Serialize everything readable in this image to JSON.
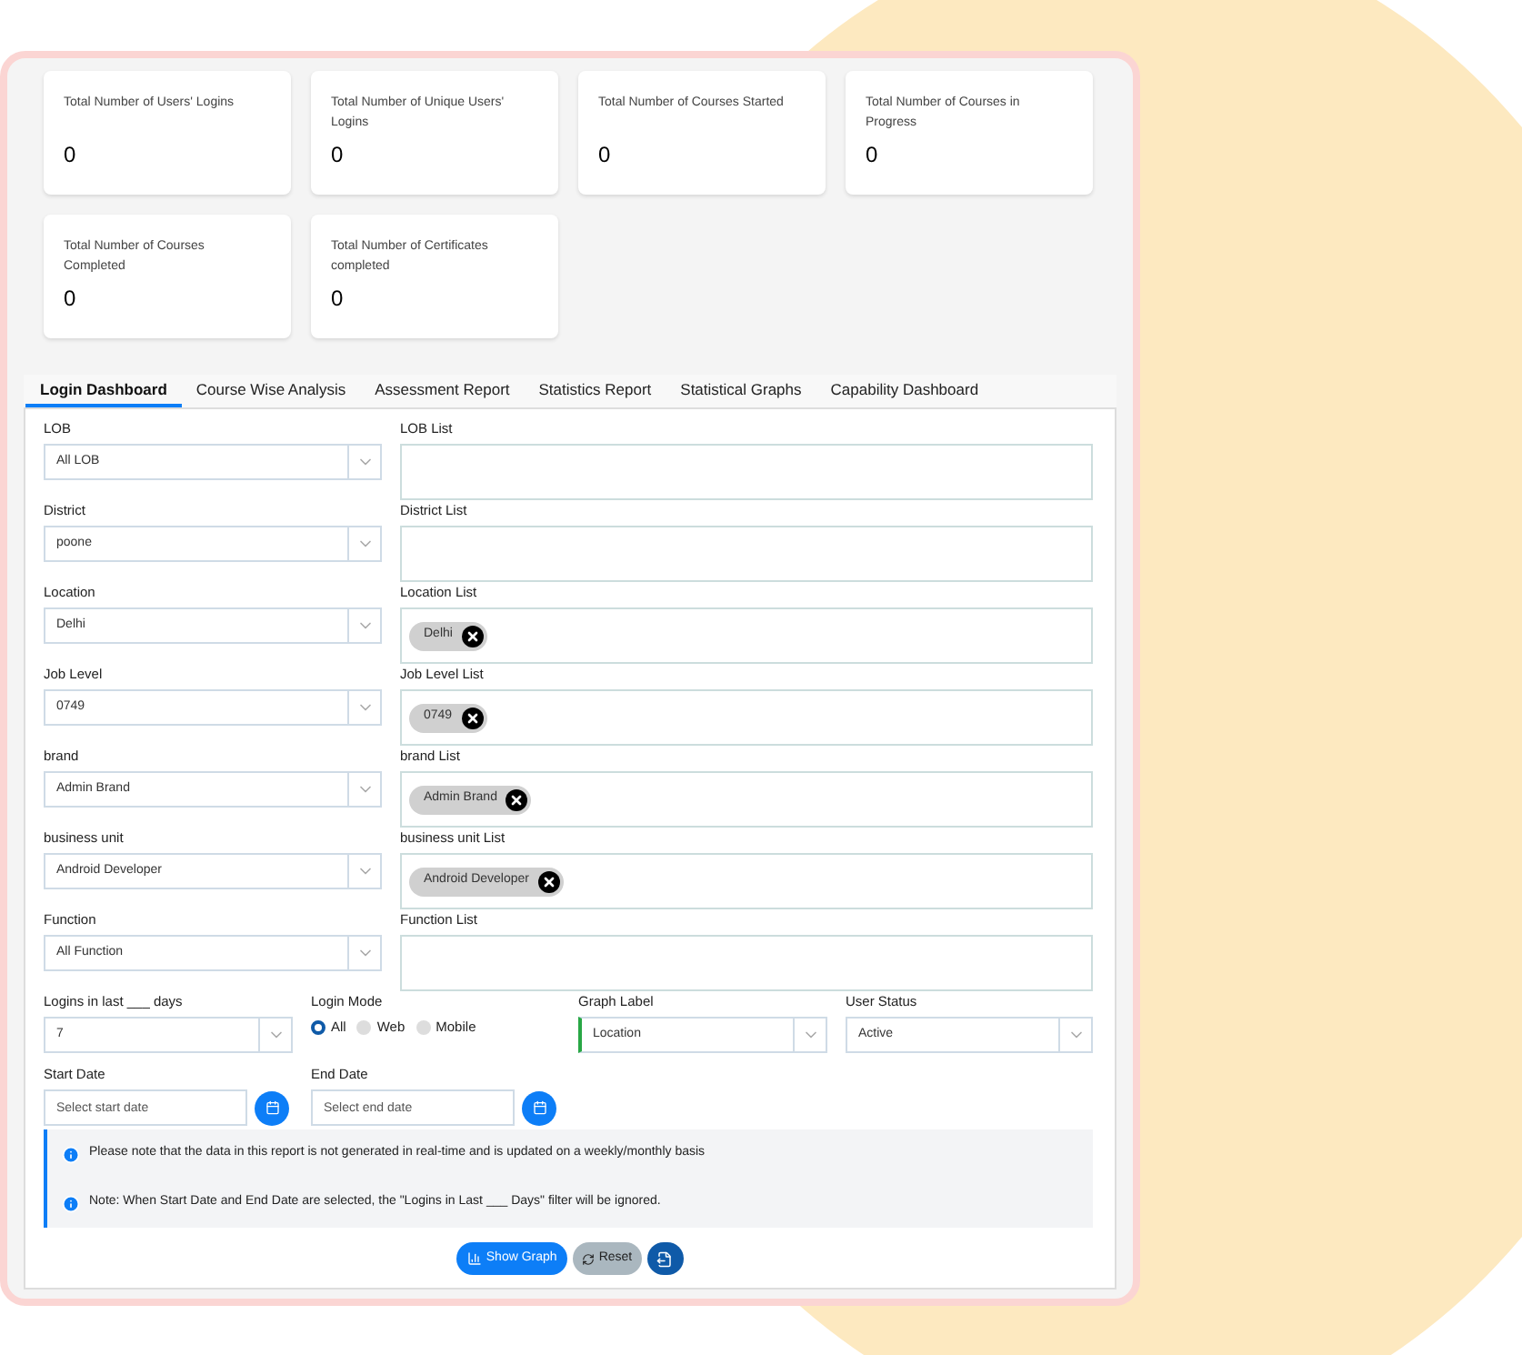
{
  "stats": [
    {
      "label": "Total Number of Users' Logins",
      "value": "0"
    },
    {
      "label": "Total Number of Unique Users' Logins",
      "value": "0"
    },
    {
      "label": "Total Number of Courses Started",
      "value": "0"
    },
    {
      "label": "Total Number of Courses in Progress",
      "value": "0"
    },
    {
      "label": "Total Number of Courses Completed",
      "value": "0"
    },
    {
      "label": "Total Number of Certificates completed",
      "value": "0"
    }
  ],
  "tabs": [
    {
      "label": "Login Dashboard",
      "selected": true
    },
    {
      "label": "Course Wise Analysis",
      "selected": false
    },
    {
      "label": "Assessment Report",
      "selected": false
    },
    {
      "label": "Statistics Report",
      "selected": false
    },
    {
      "label": "Statistical Graphs",
      "selected": false
    },
    {
      "label": "Capability Dashboard",
      "selected": false
    }
  ],
  "filters": [
    {
      "label": "LOB",
      "value": "All LOB",
      "list_label": "LOB List"
    },
    {
      "label": "District",
      "value": "poone",
      "list_label": "District List"
    },
    {
      "label": "Location",
      "value": "Delhi",
      "list_label": "Location List",
      "chips": [
        "Delhi"
      ]
    },
    {
      "label": "Job Level",
      "value": "0749",
      "list_label": "Job Level List",
      "chips": [
        "0749"
      ]
    },
    {
      "label": "brand",
      "value": "Admin Brand",
      "list_label": "brand List",
      "chips": [
        "Admin Brand"
      ]
    },
    {
      "label": "business unit",
      "value": "Android Developer",
      "list_label": "business unit List",
      "chips": [
        "Android Developer"
      ]
    },
    {
      "label": "Function",
      "value": "All Function",
      "list_label": "Function List"
    }
  ],
  "logins": {
    "label": "Logins in last ___ days",
    "value": "7"
  },
  "login_mode": {
    "label": "Login Mode",
    "options": [
      {
        "label": "All",
        "selected": true
      },
      {
        "label": "Web",
        "selected": false
      },
      {
        "label": "Mobile",
        "selected": false
      }
    ]
  },
  "graph_label": {
    "label": "Graph Label",
    "value": "Location"
  },
  "user_status": {
    "label": "User Status",
    "value": "Active"
  },
  "dates": [
    {
      "label": "Start Date",
      "placeholder": "Select start date"
    },
    {
      "label": "End Date",
      "placeholder": "Select end date"
    }
  ],
  "notes": [
    "Please note that the data in this report is not generated in real-time and is updated on a weekly/monthly basis",
    "Note: When Start Date and End Date are selected, the \"Logins in Last ___ Days\" filter will be ignored."
  ],
  "buttons": [
    {
      "kind": "chart",
      "label": "Show Graph"
    },
    {
      "kind": "reset",
      "label": "Reset"
    },
    {
      "kind": "export"
    }
  ]
}
